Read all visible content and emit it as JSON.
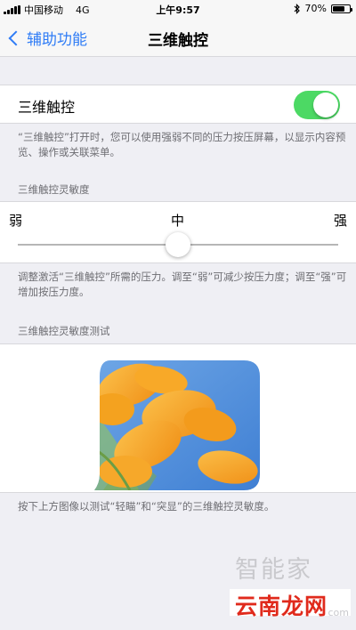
{
  "status_bar": {
    "carrier": "中国移动",
    "network": "4G",
    "time": "上午9:57",
    "battery_percent": "70%",
    "battery_level": 0.7,
    "bluetooth_icon": "bluetooth-icon"
  },
  "nav": {
    "back_label": "辅助功能",
    "title": "三维触控"
  },
  "toggle": {
    "label": "三维触控",
    "state": true,
    "color_on": "#4cd964"
  },
  "toggle_footnote": "“三维触控”打开时，您可以使用强弱不同的压力按压屏幕，以显示内容预览、操作或关联菜单。",
  "sensitivity": {
    "header": "三维触控灵敏度",
    "weak_label": "弱",
    "medium_label": "中",
    "strong_label": "强",
    "value": 0.5,
    "footnote": "调整激活“三维触控”所需的压力。调至“弱”可减少按压力度；调至“强”可增加按压力度。"
  },
  "test": {
    "header": "三维触控灵敏度测试",
    "footnote": "按下上方图像以测试“轻瞄”和“突显”的三维触控灵敏度。"
  },
  "watermark": {
    "top_text": "智能家",
    "brand_text": "云南龙网",
    "sub_text": "com"
  },
  "colors": {
    "accent": "#2f7cf6",
    "background": "#efeff4",
    "watermark_red": "#e02a1c"
  }
}
